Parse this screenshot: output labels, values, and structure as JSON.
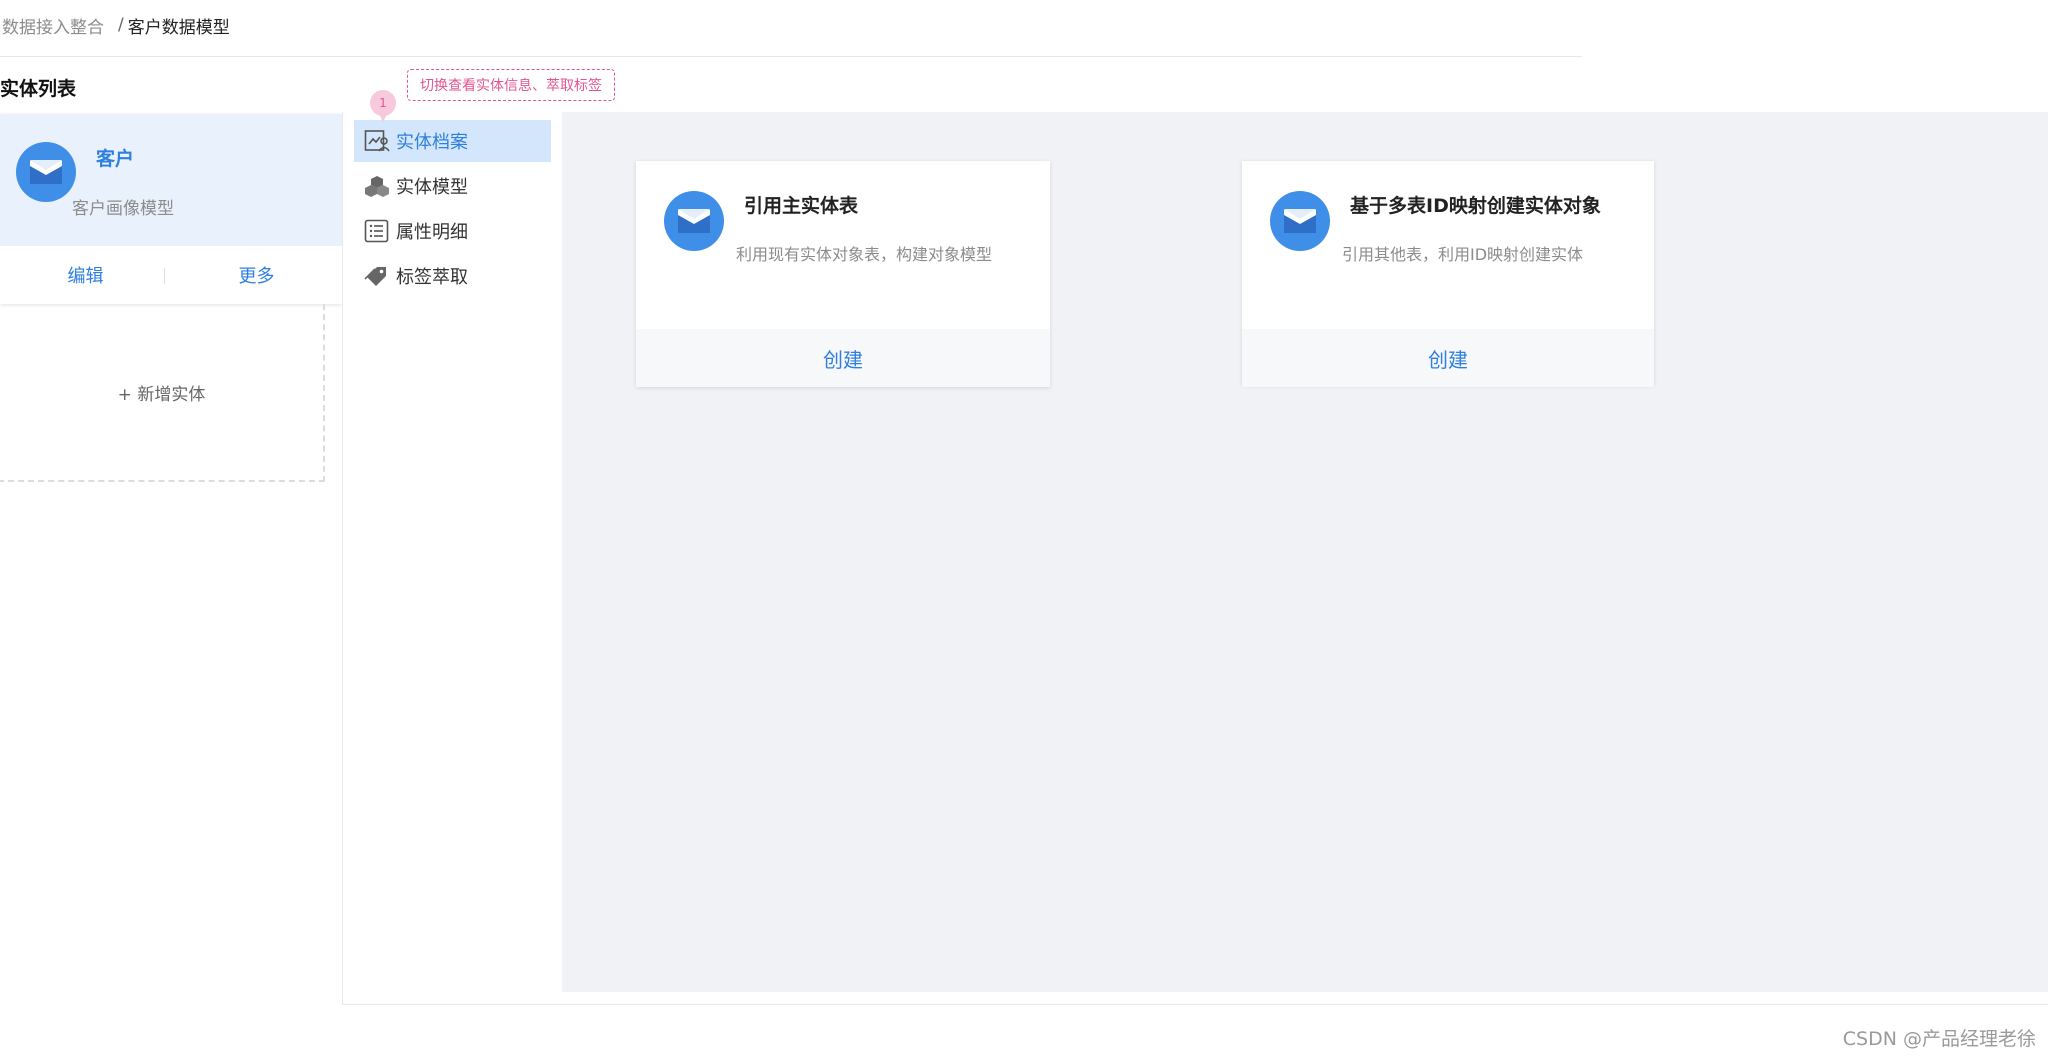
{
  "breadcrumb": {
    "parent": "数据接入整合",
    "separator": "/",
    "current": "客户数据模型"
  },
  "entity_list": {
    "title": "实体列表",
    "card": {
      "name": "客户",
      "description": "客户画像模型",
      "edit_label": "编辑",
      "more_label": "更多"
    },
    "add_label": "+ 新增实体"
  },
  "annotation": {
    "badge": "1",
    "text": "切换查看实体信息、萃取标签"
  },
  "menu": {
    "items": [
      {
        "label": "实体档案",
        "icon": "profile-icon",
        "active": true
      },
      {
        "label": "实体模型",
        "icon": "cubes-icon",
        "active": false
      },
      {
        "label": "属性明细",
        "icon": "list-icon",
        "active": false
      },
      {
        "label": "标签萃取",
        "icon": "tag-icon",
        "active": false
      }
    ]
  },
  "options": [
    {
      "title": "引用主实体表",
      "description": "利用现有实体对象表，构建对象模型",
      "action": "创建",
      "icon": "mail-icon"
    },
    {
      "title": "基于多表ID映射创建实体对象",
      "description": "引用其他表，利用ID映射创建实体",
      "action": "创建",
      "icon": "mail-icon"
    }
  ],
  "colors": {
    "accent": "#2f7fe0",
    "avatar": "#3f8fe8",
    "annotation": "#e25592",
    "active_menu_bg": "#d3e6fb",
    "content_bg": "#f0f2f5"
  },
  "watermark": "CSDN @产品经理老徐"
}
